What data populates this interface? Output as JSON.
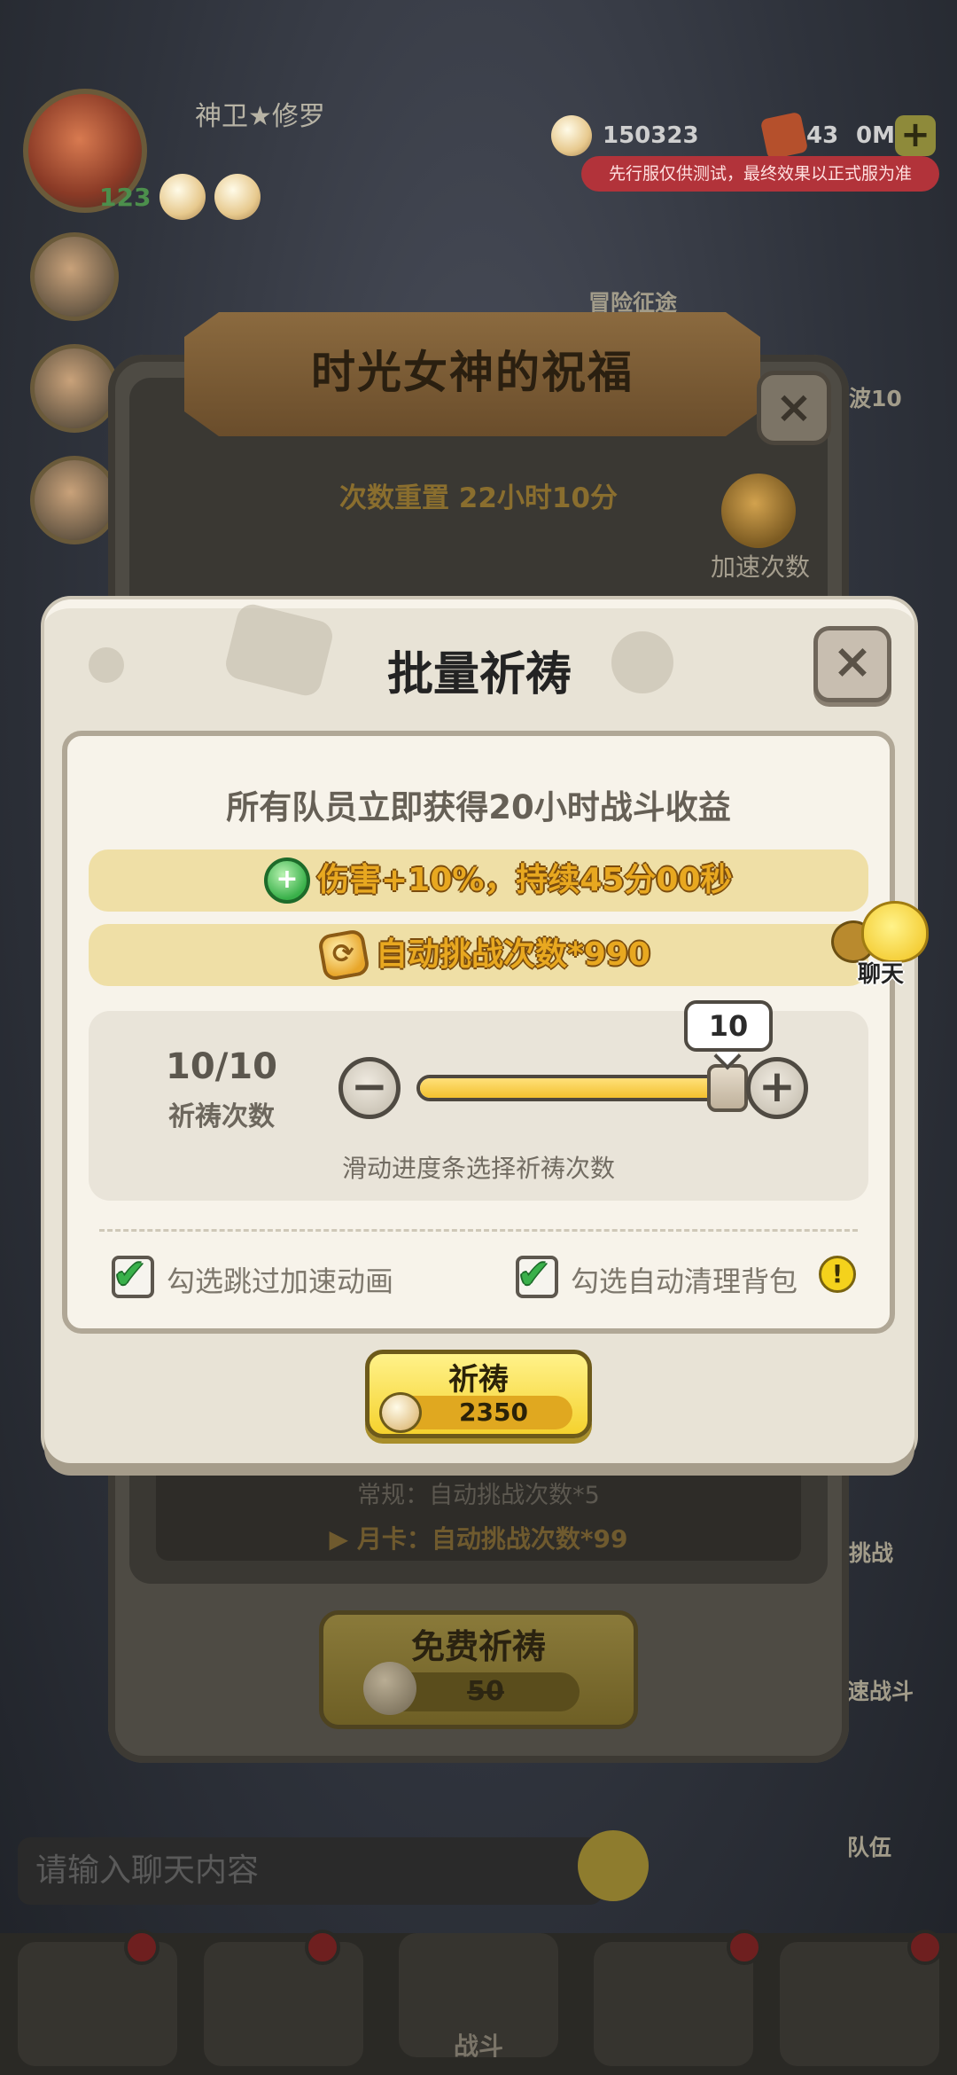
{
  "top_bar": {
    "player_name": "神卫★修罗",
    "level": "123",
    "currency1_value": "150323",
    "currency2_value": "43",
    "currency2_suffix": "0M",
    "currency3_value": "0",
    "test_notice": "先行服仅供测试，最终效果以正式服为准"
  },
  "background": {
    "side_labels": {
      "adventure": "冒险征途",
      "wave": "波10",
      "challenge": "挑战",
      "quick_battle": "速战斗",
      "team": "队伍"
    },
    "back_panel": {
      "title": "时光女神的祝福",
      "reset_timer": "次数重置 22小时10分",
      "speed_label": "加速次数",
      "normal_line": "常规：自动挑战次数*5",
      "monthly_line": "▶ 月卡：自动挑战次数*99",
      "free_button_title": "免费祈祷",
      "free_button_price": "50"
    },
    "chat_placeholder": "请输入聊天内容",
    "bottom_tab_battle": "战斗"
  },
  "dialog": {
    "title": "批量祈祷",
    "subtitle": "所有队员立即获得20小时战斗收益",
    "buff_text": "伤害+10%，持续45分00秒",
    "auto_text": "自动挑战次数*990",
    "count_value": "10/10",
    "count_label": "祈祷次数",
    "slider_value": "10",
    "slider_fraction": 1.0,
    "slider_hint": "滑动进度条选择祈祷次数",
    "skip_anim_label": "勾选跳过加速动画",
    "auto_clean_label": "勾选自动清理背包",
    "skip_anim_checked": true,
    "auto_clean_checked": true,
    "pray_button_label": "祈祷",
    "pray_cost": "2350"
  },
  "chat_float_label": "聊天",
  "colors": {
    "accent_yellow": "#f5d22e",
    "buff_text": "#e8a820",
    "check_green": "#39b04a",
    "notice_red": "#b2333a"
  },
  "icons": {
    "close": "close-icon",
    "minus": "minus-icon",
    "plus": "plus-icon",
    "check": "checkmark-icon",
    "warn": "exclamation-icon"
  }
}
